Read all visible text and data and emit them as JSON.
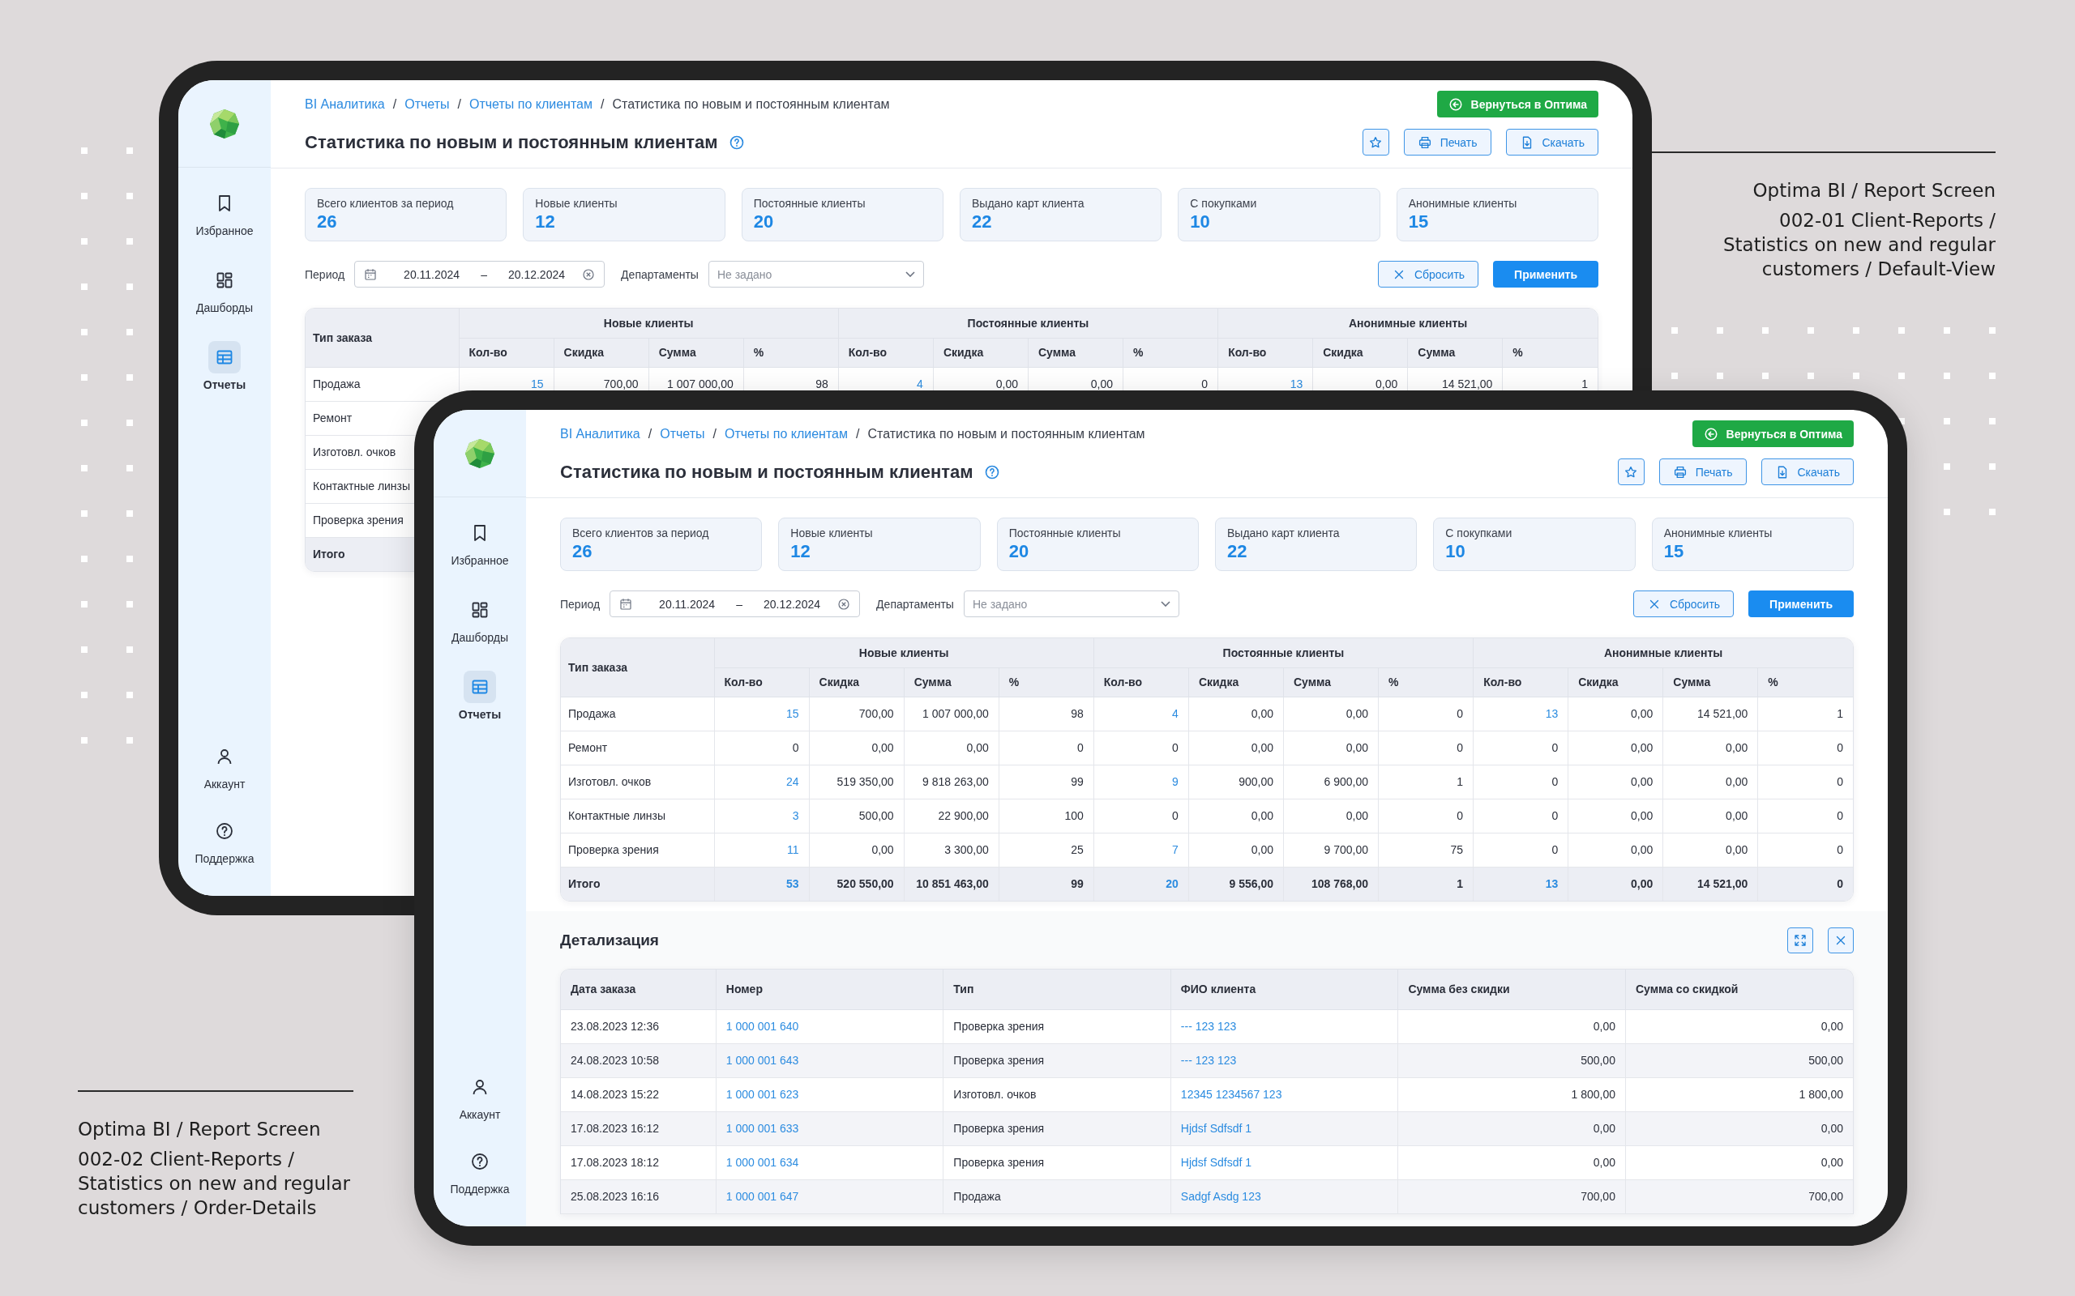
{
  "captions": [
    {
      "kind": "right",
      "title": "Optima BI / Report Screen",
      "lines": [
        "002-01 Client-Reports /",
        "Statistics on new and regular",
        "customers / Default-View"
      ]
    },
    {
      "kind": "left",
      "title": "Optima BI / Report Screen",
      "lines": [
        "002-02 Client-Reports /",
        "Statistics on new and regular",
        "customers / Order-Details"
      ]
    }
  ],
  "screens": [
    {
      "sidebar": {
        "items": [
          {
            "label": "Избранное",
            "selected": false
          },
          {
            "label": "Дашборды",
            "selected": false
          },
          {
            "label": "Отчеты",
            "selected": true
          }
        ],
        "bottom_items": [
          {
            "label": "Аккаунт"
          },
          {
            "label": "Поддержка"
          }
        ]
      },
      "breadcrumbs": [
        "BI Аналитика",
        "Отчеты",
        "Отчеты по клиентам"
      ],
      "breadcrumb_separator": "/",
      "breadcrumb_current": "Статистика по новым и постоянным клиентам",
      "return_button": "Вернуться в Оптима",
      "title": "Статистика по новым и постоянным клиентам",
      "print_button": "Печать",
      "download_button": "Скачать",
      "stats": [
        {
          "label": "Всего клиентов за период",
          "value": "26"
        },
        {
          "label": "Новые клиенты",
          "value": "12"
        },
        {
          "label": "Постоянные клиенты",
          "value": "20"
        },
        {
          "label": "Выдано карт клиента",
          "value": "22"
        },
        {
          "label": "С покупками",
          "value": "10"
        },
        {
          "label": "Анонимные клиенты",
          "value": "15"
        }
      ],
      "filters": {
        "period_label": "Период",
        "date_from": "20.11.2024",
        "date_separator": "–",
        "date_to": "20.12.2024",
        "department_label": "Департаменты",
        "department_placeholder": "Не задано",
        "reset_button": "Сбросить",
        "apply_button": "Применить"
      },
      "table": {
        "first_column": "Тип заказа",
        "groups": [
          {
            "name": "Новые клиенты",
            "columns": [
              "Кол-во",
              "Скидка",
              "Сумма",
              "%"
            ]
          },
          {
            "name": "Постоянные клиенты",
            "columns": [
              "Кол-во",
              "Скидка",
              "Сумма",
              "%"
            ]
          },
          {
            "name": "Анонимные клиенты",
            "columns": [
              "Кол-во",
              "Скидка",
              "Сумма",
              "%"
            ]
          }
        ],
        "rows": [
          {
            "kind": "data",
            "type": "Продажа",
            "groups": [
              {
                "count": "15",
                "count_link": true,
                "discount": "700,00",
                "sum": "1 007 000,00",
                "pct": "98"
              },
              {
                "count": "4",
                "count_link": true,
                "discount": "0,00",
                "sum": "0,00",
                "pct": "0"
              },
              {
                "count": "13",
                "count_link": true,
                "discount": "0,00",
                "sum": "14 521,00",
                "pct": "1"
              }
            ]
          },
          {
            "kind": "data",
            "type": "Ремонт"
          },
          {
            "kind": "data",
            "type": "Изготовл. очков"
          },
          {
            "kind": "data",
            "type": "Контактные линзы"
          },
          {
            "kind": "data",
            "type": "Проверка зрения"
          },
          {
            "kind": "total",
            "type": "Итого"
          }
        ]
      }
    },
    {
      "sidebar": {
        "items": [
          {
            "label": "Избранное",
            "selected": false
          },
          {
            "label": "Дашборды",
            "selected": false
          },
          {
            "label": "Отчеты",
            "selected": true
          }
        ],
        "bottom_items": [
          {
            "label": "Аккаунт"
          },
          {
            "label": "Поддержка"
          }
        ]
      },
      "breadcrumbs": [
        "BI Аналитика",
        "Отчеты",
        "Отчеты по клиентам"
      ],
      "breadcrumb_separator": "/",
      "breadcrumb_current": "Статистика по новым и постоянным клиентам",
      "return_button": "Вернуться в Оптима",
      "title": "Статистика по новым и постоянным клиентам",
      "print_button": "Печать",
      "download_button": "Скачать",
      "stats": [
        {
          "label": "Всего клиентов за период",
          "value": "26"
        },
        {
          "label": "Новые клиенты",
          "value": "12"
        },
        {
          "label": "Постоянные клиенты",
          "value": "20"
        },
        {
          "label": "Выдано карт клиента",
          "value": "22"
        },
        {
          "label": "С покупками",
          "value": "10"
        },
        {
          "label": "Анонимные клиенты",
          "value": "15"
        }
      ],
      "filters": {
        "period_label": "Период",
        "date_from": "20.11.2024",
        "date_separator": "–",
        "date_to": "20.12.2024",
        "department_label": "Департаменты",
        "department_placeholder": "Не задано",
        "reset_button": "Сбросить",
        "apply_button": "Применить"
      },
      "table": {
        "first_column": "Тип заказа",
        "groups": [
          {
            "name": "Новые клиенты",
            "columns": [
              "Кол-во",
              "Скидка",
              "Сумма",
              "%"
            ]
          },
          {
            "name": "Постоянные клиенты",
            "columns": [
              "Кол-во",
              "Скидка",
              "Сумма",
              "%"
            ]
          },
          {
            "name": "Анонимные клиенты",
            "columns": [
              "Кол-во",
              "Скидка",
              "Сумма",
              "%"
            ]
          }
        ],
        "rows": [
          {
            "kind": "data",
            "type": "Продажа",
            "groups": [
              {
                "count": "15",
                "count_link": true,
                "discount": "700,00",
                "sum": "1 007 000,00",
                "pct": "98"
              },
              {
                "count": "4",
                "count_link": true,
                "discount": "0,00",
                "sum": "0,00",
                "pct": "0"
              },
              {
                "count": "13",
                "count_link": true,
                "discount": "0,00",
                "sum": "14 521,00",
                "pct": "1"
              }
            ]
          },
          {
            "kind": "data",
            "type": "Ремонт",
            "groups": [
              {
                "count": "0",
                "count_link": false,
                "discount": "0,00",
                "sum": "0,00",
                "pct": "0"
              },
              {
                "count": "0",
                "count_link": false,
                "discount": "0,00",
                "sum": "0,00",
                "pct": "0"
              },
              {
                "count": "0",
                "count_link": false,
                "discount": "0,00",
                "sum": "0,00",
                "pct": "0"
              }
            ]
          },
          {
            "kind": "data",
            "type": "Изготовл. очков",
            "groups": [
              {
                "count": "24",
                "count_link": true,
                "discount": "519 350,00",
                "sum": "9 818 263,00",
                "pct": "99"
              },
              {
                "count": "9",
                "count_link": true,
                "discount": "900,00",
                "sum": "6 900,00",
                "pct": "1"
              },
              {
                "count": "0",
                "count_link": false,
                "discount": "0,00",
                "sum": "0,00",
                "pct": "0"
              }
            ]
          },
          {
            "kind": "data",
            "type": "Контактные линзы",
            "groups": [
              {
                "count": "3",
                "count_link": true,
                "discount": "500,00",
                "sum": "22 900,00",
                "pct": "100"
              },
              {
                "count": "0",
                "count_link": false,
                "discount": "0,00",
                "sum": "0,00",
                "pct": "0"
              },
              {
                "count": "0",
                "count_link": false,
                "discount": "0,00",
                "sum": "0,00",
                "pct": "0"
              }
            ]
          },
          {
            "kind": "data",
            "type": "Проверка зрения",
            "groups": [
              {
                "count": "11",
                "count_link": true,
                "discount": "0,00",
                "sum": "3 300,00",
                "pct": "25"
              },
              {
                "count": "7",
                "count_link": true,
                "discount": "0,00",
                "sum": "9 700,00",
                "pct": "75"
              },
              {
                "count": "0",
                "count_link": false,
                "discount": "0,00",
                "sum": "0,00",
                "pct": "0"
              }
            ]
          },
          {
            "kind": "total",
            "type": "Итого",
            "groups": [
              {
                "count": "53",
                "count_link": true,
                "discount": "520 550,00",
                "sum": "10 851 463,00",
                "pct": "99"
              },
              {
                "count": "20",
                "count_link": true,
                "discount": "9 556,00",
                "sum": "108 768,00",
                "pct": "1"
              },
              {
                "count": "13",
                "count_link": true,
                "discount": "0,00",
                "sum": "14 521,00",
                "pct": "0"
              }
            ]
          }
        ]
      },
      "detail": {
        "title": "Детализация",
        "columns": [
          "Дата заказа",
          "Номер",
          "Тип",
          "ФИО клиента",
          "Сумма без скидки",
          "Сумма со скидкой"
        ],
        "rows": [
          {
            "date": "23.08.2023 12:36",
            "number": "1 000 001 640",
            "type": "Проверка зрения",
            "client": "--- 123 123",
            "sum": "0,00",
            "sum_discounted": "0,00"
          },
          {
            "date": "24.08.2023 10:58",
            "number": "1 000 001 643",
            "type": "Проверка зрения",
            "client": "--- 123 123",
            "sum": "500,00",
            "sum_discounted": "500,00"
          },
          {
            "date": "14.08.2023 15:22",
            "number": "1 000 001 623",
            "type": "Изготовл. очков",
            "client": "12345 1234567 123",
            "sum": "1 800,00",
            "sum_discounted": "1 800,00"
          },
          {
            "date": "17.08.2023 16:12",
            "number": "1 000 001 633",
            "type": "Проверка зрения",
            "client": "Hjdsf Sdfsdf 1",
            "sum": "0,00",
            "sum_discounted": "0,00"
          },
          {
            "date": "17.08.2023 18:12",
            "number": "1 000 001 634",
            "type": "Проверка зрения",
            "client": "Hjdsf Sdfsdf 1",
            "sum": "0,00",
            "sum_discounted": "0,00"
          },
          {
            "date": "25.08.2023 16:16",
            "number": "1 000 001 647",
            "type": "Продажа",
            "client": "Sadgf Asdg 123",
            "sum": "700,00",
            "sum_discounted": "700,00"
          }
        ]
      }
    }
  ]
}
